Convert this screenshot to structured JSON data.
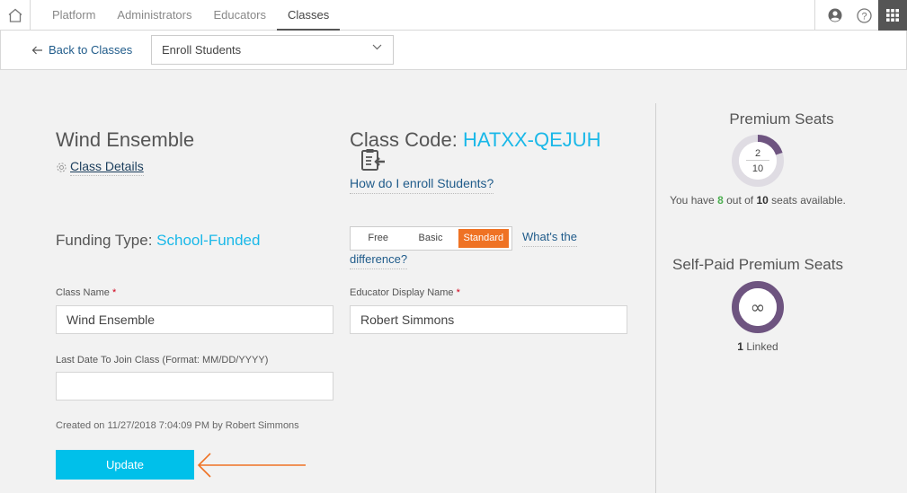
{
  "topnav": {
    "tabs": [
      {
        "label": "Platform",
        "active": false
      },
      {
        "label": "Administrators",
        "active": false
      },
      {
        "label": "Educators",
        "active": false
      },
      {
        "label": "Classes",
        "active": true
      }
    ],
    "icons": [
      "home-icon",
      "user-account-icon",
      "help-icon",
      "apps-grid-icon"
    ]
  },
  "subnav": {
    "back_label": "Back to Classes",
    "action_select": "Enroll Students"
  },
  "class": {
    "name": "Wind Ensemble",
    "details_link": "Class Details",
    "code_label": "Class Code:",
    "code": "HATXX-QEJUH",
    "enroll_help": "How do I enroll Students?",
    "funding_label": "Funding Type:",
    "funding_value": "School-Funded",
    "plan_options": [
      "Free",
      "Basic",
      "Standard"
    ],
    "plan_selected": "Standard",
    "whats_diff_line1": "What's the",
    "whats_diff_line2": "difference?"
  },
  "form": {
    "class_name_label": "Class Name",
    "class_name_value": "Wind Ensemble",
    "educator_label": "Educator Display Name",
    "educator_value": "Robert Simmons",
    "last_date_label": "Last Date To Join Class (Format: MM/DD/YYYY)",
    "last_date_value": "",
    "required_mark": "*",
    "created": "Created on 11/27/2018 7:04:09 PM by Robert Simmons",
    "update_label": "Update"
  },
  "sidebar": {
    "premium_title": "Premium Seats",
    "premium_used": "2",
    "premium_total": "10",
    "premium_used_fraction": 0.2,
    "seats_prefix": "You have",
    "seats_available": "8",
    "seats_mid": "out of",
    "seats_total": "10",
    "seats_suffix": "seats available.",
    "selfpaid_title": "Self-Paid Premium Seats",
    "selfpaid_symbol": "∞",
    "linked_count": "1",
    "linked_label": "Linked"
  },
  "colors": {
    "accent_cyan": "#1ab8e8",
    "update_button": "#00c0ea",
    "selected_plan": "#ef7224",
    "donut_purple": "#6e5480",
    "available_green": "#4caf50",
    "link_blue": "#1f5b8a"
  }
}
